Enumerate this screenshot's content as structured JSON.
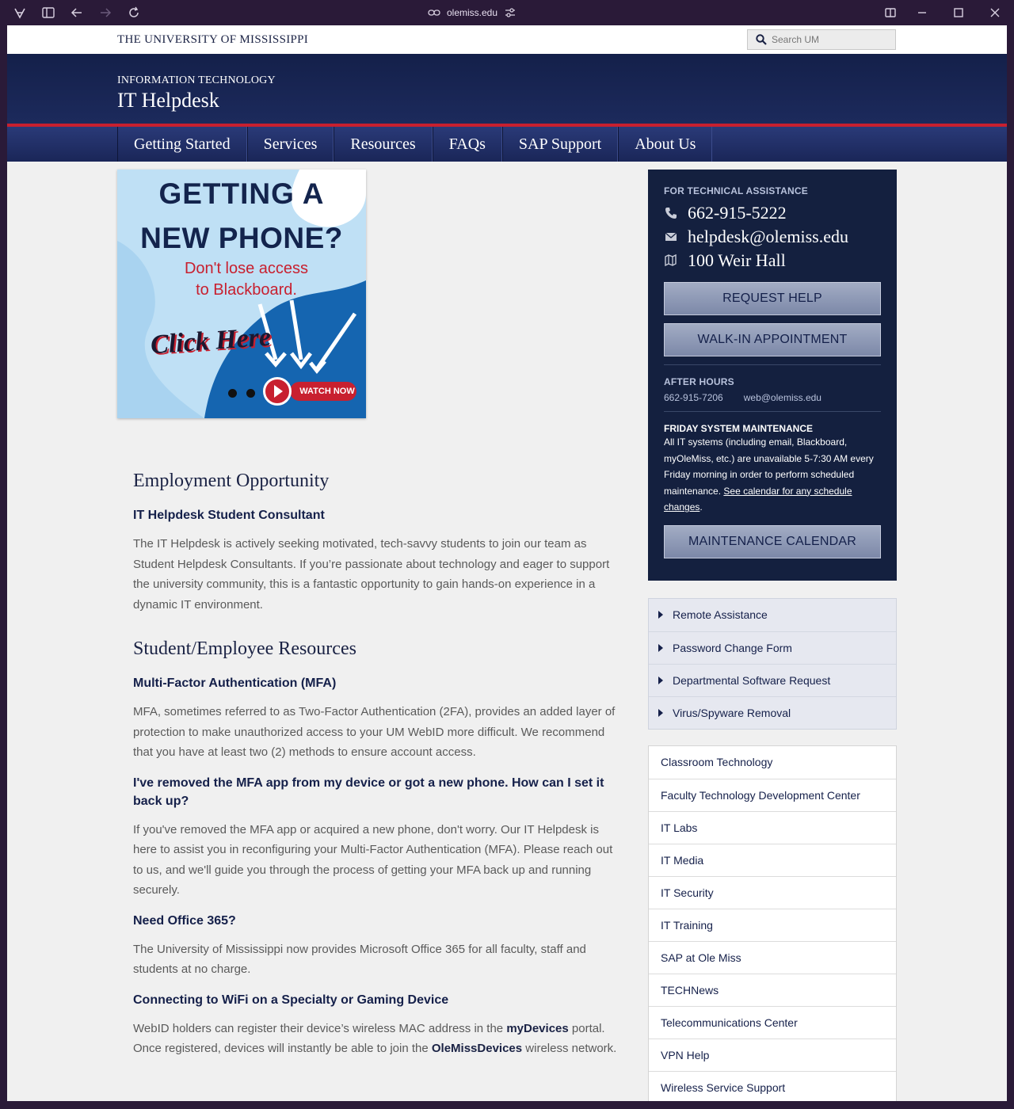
{
  "browser": {
    "url": "olemiss.edu"
  },
  "topbar": {
    "university": "THE UNIVERSITY OF MISSISSIPPI",
    "search_placeholder": "Search UM"
  },
  "header": {
    "department": "INFORMATION TECHNOLOGY",
    "site_title": "IT Helpdesk"
  },
  "nav": {
    "items": [
      "Getting Started",
      "Services",
      "Resources",
      "FAQs",
      "SAP Support",
      "About Us"
    ]
  },
  "promo": {
    "line1": "GETTING A",
    "line2": "NEW PHONE?",
    "line3a": "Don't lose access",
    "line3b": "to Blackboard.",
    "click": "Click Here",
    "watch": "WATCH NOW"
  },
  "content": {
    "employment_heading": "Employment Opportunity",
    "employment_sub": "IT Helpdesk Student Consultant",
    "employment_text": "The IT Helpdesk is actively seeking motivated, tech-savvy students to join our team as Student Helpdesk Consultants. If you’re passionate about technology and eager to support the university community, this is a fantastic opportunity to gain hands-on experience in a dynamic IT environment.",
    "resources_heading": "Student/Employee Resources",
    "mfa_heading": "Multi-Factor Authentication (MFA)",
    "mfa_text": "MFA, sometimes referred to as Two-Factor Authentication (2FA), provides an added layer of protection to make unauthorized access to your UM WebID more difficult. We recommend that you have at least two (2) methods to ensure account access.",
    "removed_heading": "I've removed the MFA app from my device or got a new phone. How can I set it back up?",
    "removed_text": "If you've removed the MFA app or acquired a new phone, don't worry. Our IT Helpdesk is here to assist you in reconfiguring your Multi-Factor Authentication (MFA). Please reach out to us, and we'll guide you through the process of getting your MFA back up and running securely.",
    "office_heading": "Need Office 365?",
    "office_text": "The University of Mississippi now provides Microsoft Office 365 for all faculty, staff and students at no charge.",
    "wifi_heading": "Connecting to WiFi on a Specialty or Gaming Device",
    "wifi_text_1": "WebID holders can register their device’s wireless MAC address in the ",
    "wifi_link_1": "myDevices",
    "wifi_text_2": " portal. Once registered, devices will instantly be able to join the ",
    "wifi_link_2": "OleMissDevices",
    "wifi_text_3": " wireless network."
  },
  "sidebar": {
    "assist_label": "FOR TECHNICAL ASSISTANCE",
    "phone": "662-915-5222",
    "email": "helpdesk@olemiss.edu",
    "location": "100 Weir Hall",
    "request_help": "REQUEST HELP",
    "walk_in": "WALK-IN APPOINTMENT",
    "after_hours_label": "AFTER HOURS",
    "after_phone": "662-915-7206",
    "after_email": "web@olemiss.edu",
    "maint_title": "FRIDAY SYSTEM MAINTENANCE",
    "maint_text": "All IT systems (including email, Blackboard, myOleMiss, etc.) are unavailable 5-7:30 AM every Friday morning in order to perform scheduled maintenance. ",
    "maint_link": "See calendar for any schedule changes",
    "maint_period": ".",
    "maint_calendar": "MAINTENANCE CALENDAR",
    "quick_links": [
      "Remote Assistance",
      "Password Change Form",
      "Departmental Software Request",
      "Virus/Spyware Removal"
    ],
    "dept_links": [
      "Classroom Technology",
      "Faculty Technology Development Center",
      "IT Labs",
      "IT Media",
      "IT Security",
      "IT Training",
      "SAP at Ole Miss",
      "TECHNews",
      "Telecommunications Center",
      "VPN Help",
      "Wireless Service Support"
    ]
  }
}
